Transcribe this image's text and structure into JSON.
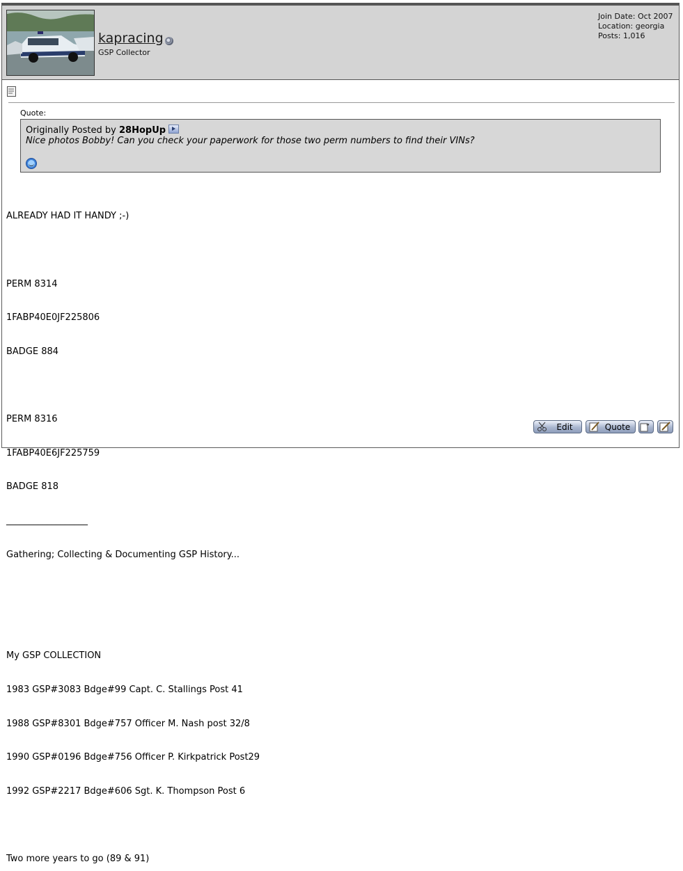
{
  "user": {
    "username": "kapracing",
    "title": "GSP Collector",
    "join_date": "Join Date: Oct 2007",
    "location": "Location: georgia",
    "posts": "Posts: 1,016"
  },
  "quote": {
    "label": "Quote:",
    "originally_posted_by": "Originally Posted by",
    "author": "28HopUp",
    "text": "Nice photos Bobby! Can you check your paperwork for those two perm numbers to find their VINs?"
  },
  "post": {
    "lines": [
      "ALREADY HAD IT HANDY ;-)",
      "",
      "PERM 8314",
      "1FABP40E0JF225806",
      "BADGE 884",
      "",
      "PERM 8316",
      "1FABP40E6JF225759",
      "BADGE 818",
      "__________________",
      "Gathering; Collecting & Documenting GSP History...",
      "",
      "",
      "My GSP COLLECTION",
      "1983 GSP#3083 Bdge#99 Capt. C. Stallings Post 41",
      "1988 GSP#8301 Bdge#757 Officer M. Nash post 32/8",
      "1990 GSP#0196 Bdge#756 Officer P. Kirkpatrick Post29",
      "1992 GSP#2217 Bdge#606 Sgt. K. Thompson Post 6",
      "",
      "Two more years to go (89 & 91)"
    ]
  },
  "buttons": {
    "edit": "Edit",
    "quote": "Quote"
  }
}
